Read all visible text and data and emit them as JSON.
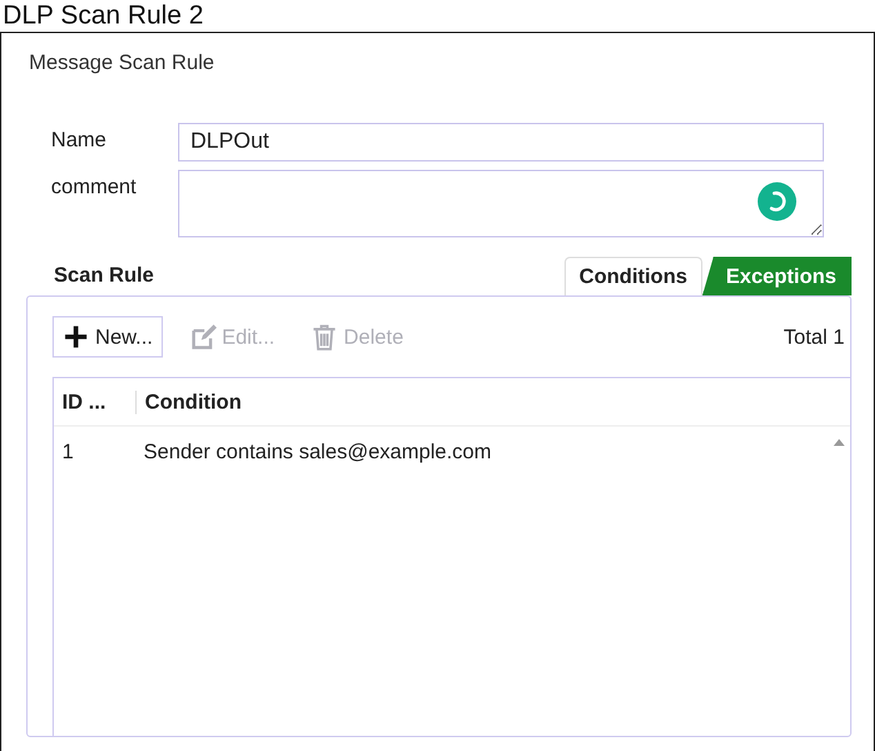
{
  "page_title": "DLP Scan Rule 2",
  "panel": {
    "title": "Message Scan Rule",
    "fields": [
      {
        "kind": "text",
        "label": "Name",
        "value": "DLPOut"
      },
      {
        "kind": "textarea",
        "label": "comment"
      }
    ],
    "section_title": "Scan Rule",
    "tabs": [
      {
        "label": "Conditions",
        "selected": false
      },
      {
        "label": "Exceptions",
        "selected": true
      }
    ],
    "toolbar": [
      {
        "kind": "new",
        "label": "New...",
        "disabled": false
      },
      {
        "kind": "edit",
        "label": "Edit...",
        "disabled": true
      },
      {
        "kind": "delete",
        "label": "Delete",
        "disabled": true
      }
    ],
    "total": "Total 1",
    "table": {
      "columns": [
        "ID ...",
        "Condition"
      ],
      "rows": [
        [
          "1",
          "Sender contains sales@example.com"
        ]
      ]
    }
  }
}
